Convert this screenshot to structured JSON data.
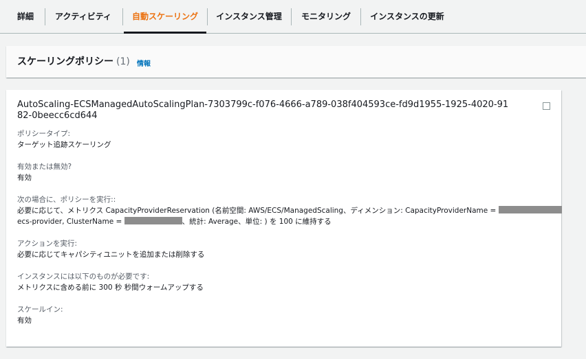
{
  "tabs": [
    {
      "label": "詳細",
      "active": false
    },
    {
      "label": "アクティビティ",
      "active": false
    },
    {
      "label": "自動スケーリング",
      "active": true
    },
    {
      "label": "インスタンス管理",
      "active": false
    },
    {
      "label": "モニタリング",
      "active": false
    },
    {
      "label": "インスタンスの更新",
      "active": false
    }
  ],
  "section": {
    "title": "スケーリングポリシー",
    "count": "(1)",
    "info": "情報"
  },
  "policy": {
    "name": "AutoScaling-ECSManagedAutoScalingPlan-7303799c-f076-4666-a789-038f404593ce-fd9d1955-1925-4020-9182-0beecc6cd644",
    "type_label": "ポリシータイプ:",
    "type_value": "ターゲット追跡スケーリング",
    "enabled_label": "有効または無効?",
    "enabled_value": "有効",
    "condition_label": "次の場合に、ポリシーを実行::",
    "condition_line1": "必要に応じて、メトリクス CapacityProviderReservation (名前空間: AWS/ECS/ManagedScaling、ディメンション: CapacityProviderName =",
    "condition_line2_a": "ecs-provider, ClusterName =",
    "condition_line2_b": "、統計: Average、単位: ) を 100 に維持する",
    "action_label": "アクションを実行:",
    "action_value": "必要に応じてキャパシティユニットを追加または削除する",
    "warmup_label": "インスタンスには以下のものが必要です:",
    "warmup_value": "メトリクスに含める前に 300 秒 秒間ウォームアップする",
    "scalein_label": "スケールイン:",
    "scalein_value": "有効"
  },
  "colors": {
    "accent": "#ec7211",
    "link": "#0073bb",
    "background": "#f2f3f3"
  }
}
